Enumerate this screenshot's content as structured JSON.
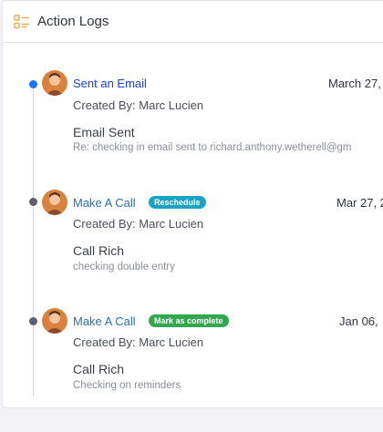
{
  "header": {
    "title": "Action Logs",
    "icon": "list-icon"
  },
  "colors": {
    "accent_orange": "#f5a54a",
    "dot_blue": "#1677ff",
    "dot_gray": "#5a5f73",
    "link_blue": "#2c6fb7",
    "link_active": "#1a3df5",
    "badge_teal": "#1aa3c4",
    "badge_green": "#2fa84f"
  },
  "entries": [
    {
      "action": "Sent an Email",
      "badge": "",
      "date": "March 27,",
      "created_by": "Created By: Marc Lucien",
      "subject": "Email Sent",
      "detail": "Re: checking in email sent to richard.anthony.wetherell@gm"
    },
    {
      "action": "Make A Call",
      "badge": "Reschedule",
      "date": "Mar 27, 2",
      "created_by": "Created By: Marc Lucien",
      "subject": "Call Rich",
      "detail": "checking double entry"
    },
    {
      "action": "Make A Call",
      "badge": "Mark as complete",
      "date": "Jan 06,",
      "created_by": "Created By: Marc Lucien",
      "subject": "Call Rich",
      "detail": "Checking on reminders"
    }
  ]
}
